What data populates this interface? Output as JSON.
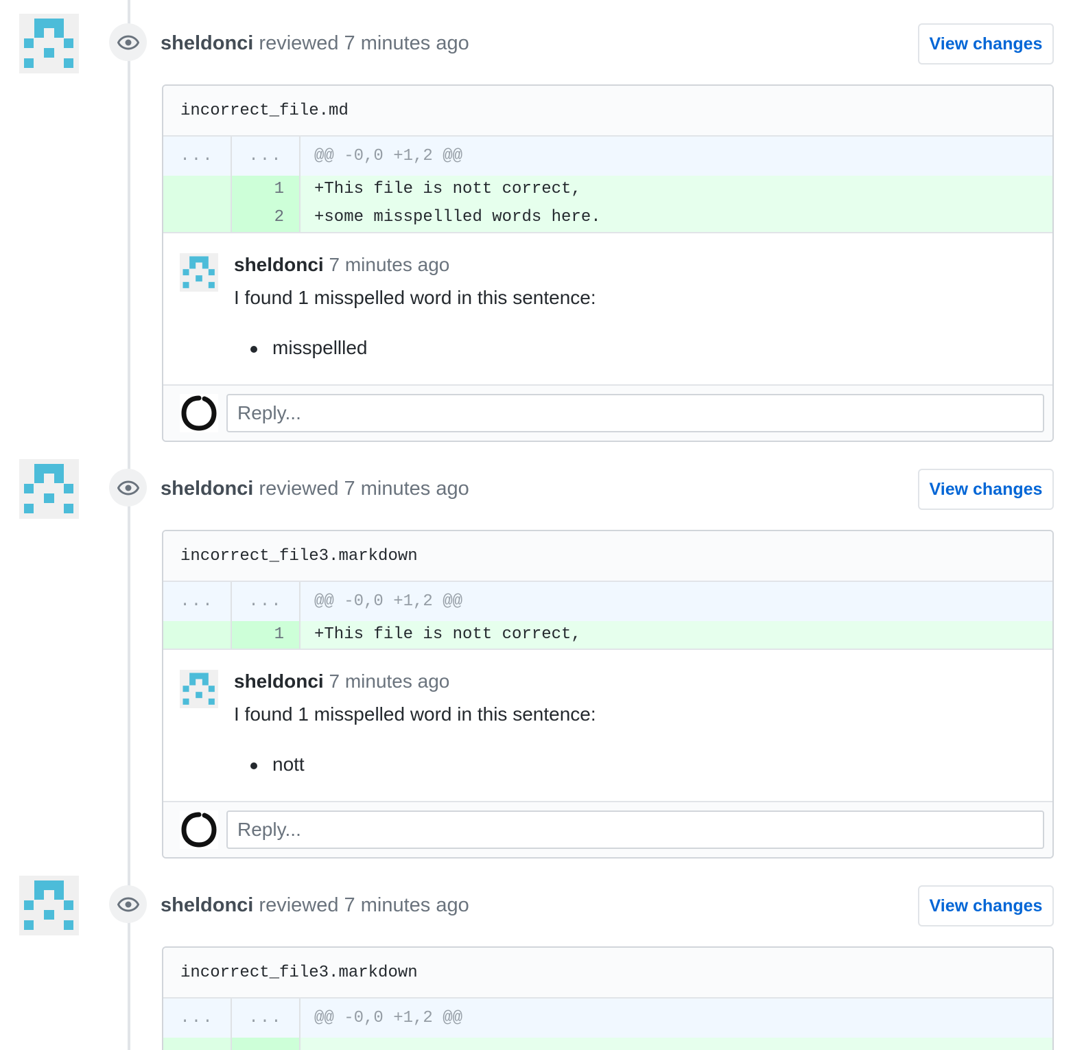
{
  "reviews": [
    {
      "author": "sheldonci",
      "action": "reviewed 7 minutes ago",
      "view_changes_label": "View changes",
      "file_name": "incorrect_file.md",
      "hunk": {
        "left": "...",
        "right": "...",
        "header": "@@ -0,0 +1,2 @@"
      },
      "lines": [
        {
          "num": "1",
          "code": "+This file is nott correct,"
        },
        {
          "num": "2",
          "code": "+some misspellled words here."
        }
      ],
      "comment": {
        "author": "sheldonci",
        "time": "7 minutes ago",
        "text": "I found 1 misspelled word in this sentence:",
        "items": [
          "misspellled"
        ]
      },
      "reply_placeholder": "Reply..."
    },
    {
      "author": "sheldonci",
      "action": "reviewed 7 minutes ago",
      "view_changes_label": "View changes",
      "file_name": "incorrect_file3.markdown",
      "hunk": {
        "left": "...",
        "right": "...",
        "header": "@@ -0,0 +1,2 @@"
      },
      "lines": [
        {
          "num": "1",
          "code": "+This file is nott correct,"
        }
      ],
      "comment": {
        "author": "sheldonci",
        "time": "7 minutes ago",
        "text": "I found 1 misspelled word in this sentence:",
        "items": [
          "nott"
        ]
      },
      "reply_placeholder": "Reply..."
    },
    {
      "author": "sheldonci",
      "action": "reviewed 7 minutes ago",
      "view_changes_label": "View changes",
      "file_name": "incorrect_file3.markdown",
      "hunk": {
        "left": "...",
        "right": "...",
        "header": "@@ -0,0 +1,2 @@"
      }
    }
  ],
  "icons": {
    "review_event": "eye-icon",
    "bot_avatar": "identicon-avatar",
    "user_avatar": "enso-circle-avatar"
  },
  "colors": {
    "link": "#0366d6",
    "addition_bg": "#e6ffed",
    "hunk_bg": "#f1f8ff",
    "identicon": "#4cbcd9"
  }
}
